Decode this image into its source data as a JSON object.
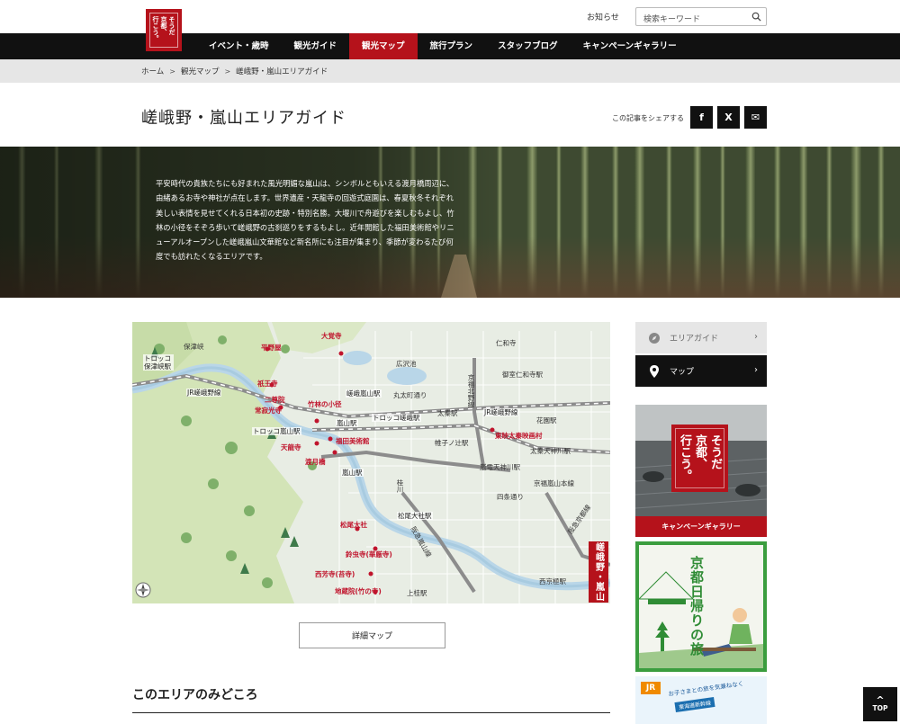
{
  "header": {
    "logo_cols": [
      "そうだ",
      "京都、",
      "行こう。"
    ],
    "notice_link": "お知らせ",
    "search_placeholder": "検索キーワード"
  },
  "nav": {
    "items": [
      "イベント・歳時",
      "観光ガイド",
      "観光マップ",
      "旅行プラン",
      "スタッフブログ",
      "キャンペーンギャラリー"
    ],
    "active_index": 2
  },
  "breadcrumb": [
    "ホーム",
    "観光マップ",
    "嵯峨野・嵐山エリアガイド"
  ],
  "page": {
    "title": "嵯峨野・嵐山エリアガイド",
    "share_label": "この記事をシェアする",
    "share_buttons": [
      "f",
      "X",
      "✉"
    ]
  },
  "hero": {
    "text": "平安時代の貴族たちにも好まれた風光明媚な嵐山は、シンボルともいえる渡月橋周辺に、由緒あるお寺や神社が点在します。世界遺産・天龍寺の回遊式庭園は、春夏秋冬それぞれ美しい表情を見せてくれる日本初の史跡・特別名勝。大堰川で舟遊びを楽しむもよし、竹林の小径をそぞろ歩いて嵯峨野の古刹巡りをするもよし。近年開館した福田美術館やリニューアルオープンした嵯峨嵐山文華館など新名所にも注目が集まり、季節が変わるたび何度でも訪れたくなるエリアです。"
  },
  "map": {
    "badge": "嵯峨野・嵐山",
    "spots": [
      "平野屋",
      "大覚寺",
      "祇王寺",
      "二尊院",
      "常寂光寺",
      "竹林の小径",
      "天龍寺",
      "福田美術館",
      "渡月橋",
      "東映太秦映画村",
      "松尾大社",
      "鈴虫寺(華厳寺)",
      "西芳寺(苔寺)",
      "地蔵院(竹の寺)"
    ],
    "places": [
      "保津峡",
      "広沢池",
      "仁和寺",
      "御室仁和寺駅",
      "丸太町通り",
      "京福北野線",
      "太秦駅",
      "花園駅",
      "帷子ノ辻駅",
      "太秦天神川駅",
      "嵐電天神川駅",
      "京福嵐山本線",
      "四条通り",
      "桂川",
      "阪急嵐山線",
      "阪急京都線",
      "西京極駅",
      "上桂駅"
    ],
    "stations": [
      "トロッコ保津峡駅",
      "JR嵯峨野線",
      "嵯峨嵐山駅",
      "トロッコ嵯峨駅",
      "嵐山駅",
      "トロッコ嵐山駅",
      "嵐山駅",
      "松尾大社駅",
      "JR嵯峨野線"
    ]
  },
  "detail_button": "詳細マップ",
  "section_title": "このエリアのみどころ",
  "sidebar": {
    "items": [
      "エリアガイド",
      "マップ"
    ],
    "banner1_caption": "キャンペーンギャラリー",
    "banner1_logo_cols": [
      "そうだ",
      "京都、",
      "行こう。"
    ],
    "banner2_title": "京都日帰りの旅",
    "banner3_text": "お子さまとの旅を気兼ねなく",
    "banner3_tag": "東海道新幹線",
    "banner3_jr": "JR"
  },
  "top_button": "TOP",
  "colors": {
    "brand_red": "#b5121b",
    "nav_black": "#111111",
    "spot_red": "#c0142c",
    "green": "#3a9d3e"
  }
}
